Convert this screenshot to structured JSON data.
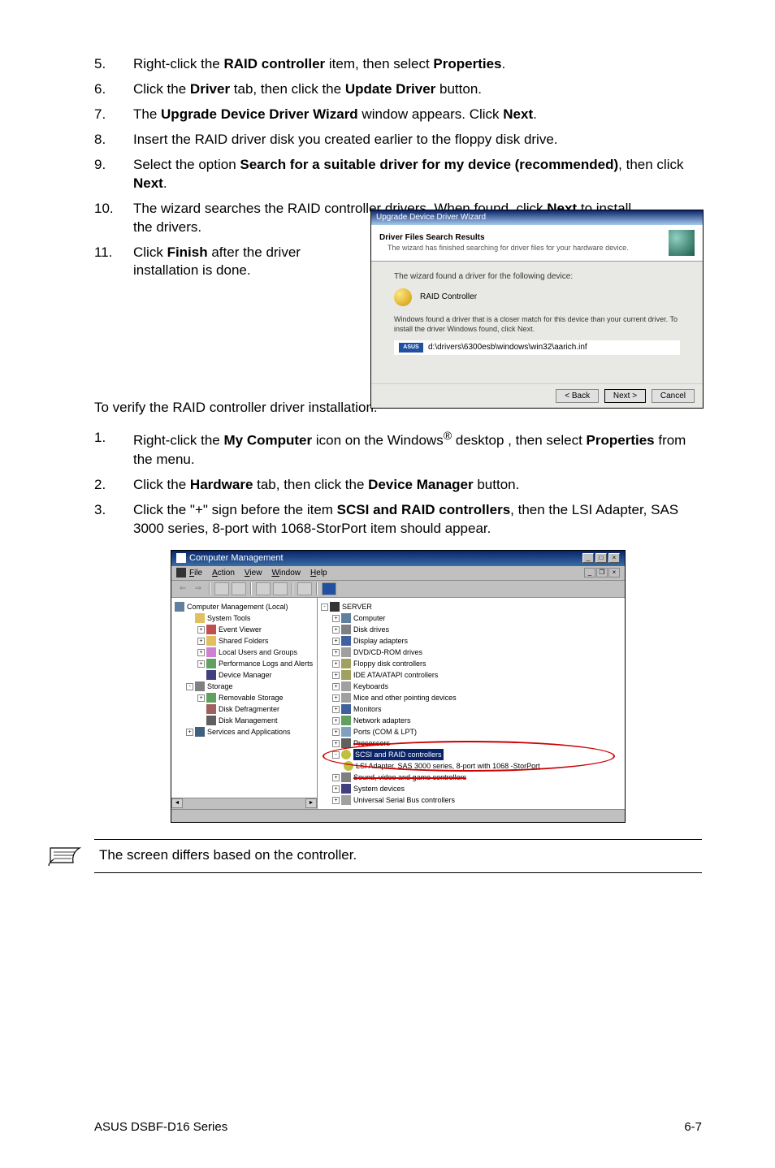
{
  "steps1": [
    {
      "n": "5.",
      "text": "Right-click the {b}RAID controller{/b} item, then select {b}Properties{/b}."
    },
    {
      "n": "6.",
      "text": "Click the {b}Driver{/b} tab, then click the {b}Update Driver{/b} button."
    },
    {
      "n": "7.",
      "text": "The {b}Upgrade Device Driver Wizard{/b} window appears. Click {b}Next{/b}."
    },
    {
      "n": "8.",
      "text": "Insert the RAID driver disk you created earlier to the floppy disk drive."
    },
    {
      "n": "9.",
      "text": "Select the option {b}Search for a suitable driver for my device (recommended){/b}, then click {b}Next{/b}."
    },
    {
      "n": "10.",
      "text": "The wizard searches the RAID controller drivers. When found, click {b}Next{/b} to install the drivers."
    },
    {
      "n": "11.",
      "text": "Click {b}Finish{/b} after the driver installation is done."
    }
  ],
  "wizard": {
    "title": "Upgrade Device Driver Wizard",
    "header_bold": "Driver Files Search Results",
    "header_sub": "The wizard has finished searching for driver files for your hardware device.",
    "found_line": "The wizard found a driver for the following device:",
    "device": "RAID Controller",
    "match_line": "Windows found a driver that is a closer match for this device than your current driver. To install the driver Windows found, click Next.",
    "path": "d:\\drivers\\6300esb\\windows\\win32\\aarich.inf",
    "back": "< Back",
    "next": "Next >",
    "cancel": "Cancel",
    "asus": "ASUS"
  },
  "verify_heading": "To verify the RAID controller driver installation:",
  "steps2": [
    {
      "n": "1.",
      "html": "Right-click the {b}My Computer{/b} icon on the Windows{sup}®{/sup} desktop , then select {b}Properties{/b} from the menu."
    },
    {
      "n": "2.",
      "html": "Click the {b}Hardware{/b} tab, then click the {b}Device Manager{/b} button."
    },
    {
      "n": "3.",
      "html": "Click the \"+\" sign before the item {b}SCSI and RAID controllers{/b}, then the LSI Adapter, SAS 3000 series, 8-port with 1068-StorPort item should appear."
    }
  ],
  "cm": {
    "title": "Computer Management",
    "menus": [
      "File",
      "Action",
      "View",
      "Window",
      "Help"
    ],
    "left_root": "Computer Management (Local)",
    "left_tree": [
      {
        "label": "System Tools",
        "icon": "folder"
      },
      {
        "label": "Event Viewer",
        "icon": "book",
        "indent": 2,
        "exp": "+"
      },
      {
        "label": "Shared Folders",
        "icon": "share",
        "indent": 2,
        "exp": "+"
      },
      {
        "label": "Local Users and Groups",
        "icon": "users",
        "indent": 2,
        "exp": "+"
      },
      {
        "label": "Performance Logs and Alerts",
        "icon": "perf",
        "indent": 2,
        "exp": "+"
      },
      {
        "label": "Device Manager",
        "icon": "device",
        "indent": 2
      },
      {
        "label": "Storage",
        "icon": "storage",
        "indent": 1,
        "exp": "-"
      },
      {
        "label": "Removable Storage",
        "icon": "remov",
        "indent": 2,
        "exp": "+"
      },
      {
        "label": "Disk Defragmenter",
        "icon": "defrag",
        "indent": 2
      },
      {
        "label": "Disk Management",
        "icon": "diskmgmt",
        "indent": 2
      },
      {
        "label": "Services and Applications",
        "icon": "services",
        "indent": 1,
        "exp": "+"
      }
    ],
    "right_root": "SERVER",
    "right_tree": [
      {
        "label": "Computer",
        "icon": "computer",
        "exp": "+"
      },
      {
        "label": "Disk drives",
        "icon": "disk",
        "exp": "+"
      },
      {
        "label": "Display adapters",
        "icon": "display",
        "exp": "+"
      },
      {
        "label": "DVD/CD-ROM drives",
        "icon": "dvd",
        "exp": "+"
      },
      {
        "label": "Floppy disk controllers",
        "icon": "fdc",
        "exp": "+"
      },
      {
        "label": "IDE ATA/ATAPI controllers",
        "icon": "ide",
        "exp": "+"
      },
      {
        "label": "Keyboards",
        "icon": "kbd",
        "exp": "+"
      },
      {
        "label": "Mice and other pointing devices",
        "icon": "mouse",
        "exp": "+"
      },
      {
        "label": "Monitors",
        "icon": "mon",
        "exp": "+"
      },
      {
        "label": "Network adapters",
        "icon": "net",
        "exp": "+"
      },
      {
        "label": "Ports (COM & LPT)",
        "icon": "ports",
        "exp": "+"
      },
      {
        "label": "Processors",
        "icon": "proc",
        "exp": "+",
        "strike": true
      }
    ],
    "scsi_header": "SCSI and RAID controllers",
    "lsi": "LSI Adapter, SAS 3000 series, 8-port with 1068 -StorPort",
    "right_tree2": [
      {
        "label": "Sound, video and game controllers",
        "icon": "dev",
        "exp": "+",
        "strike": true
      },
      {
        "label": "System devices",
        "icon": "sys",
        "exp": "+"
      },
      {
        "label": "Universal Serial Bus controllers",
        "icon": "usb",
        "exp": "+"
      }
    ]
  },
  "note": "The screen differs based on the controller.",
  "footer_left": "ASUS DSBF-D16 Series",
  "footer_right": "6-7"
}
